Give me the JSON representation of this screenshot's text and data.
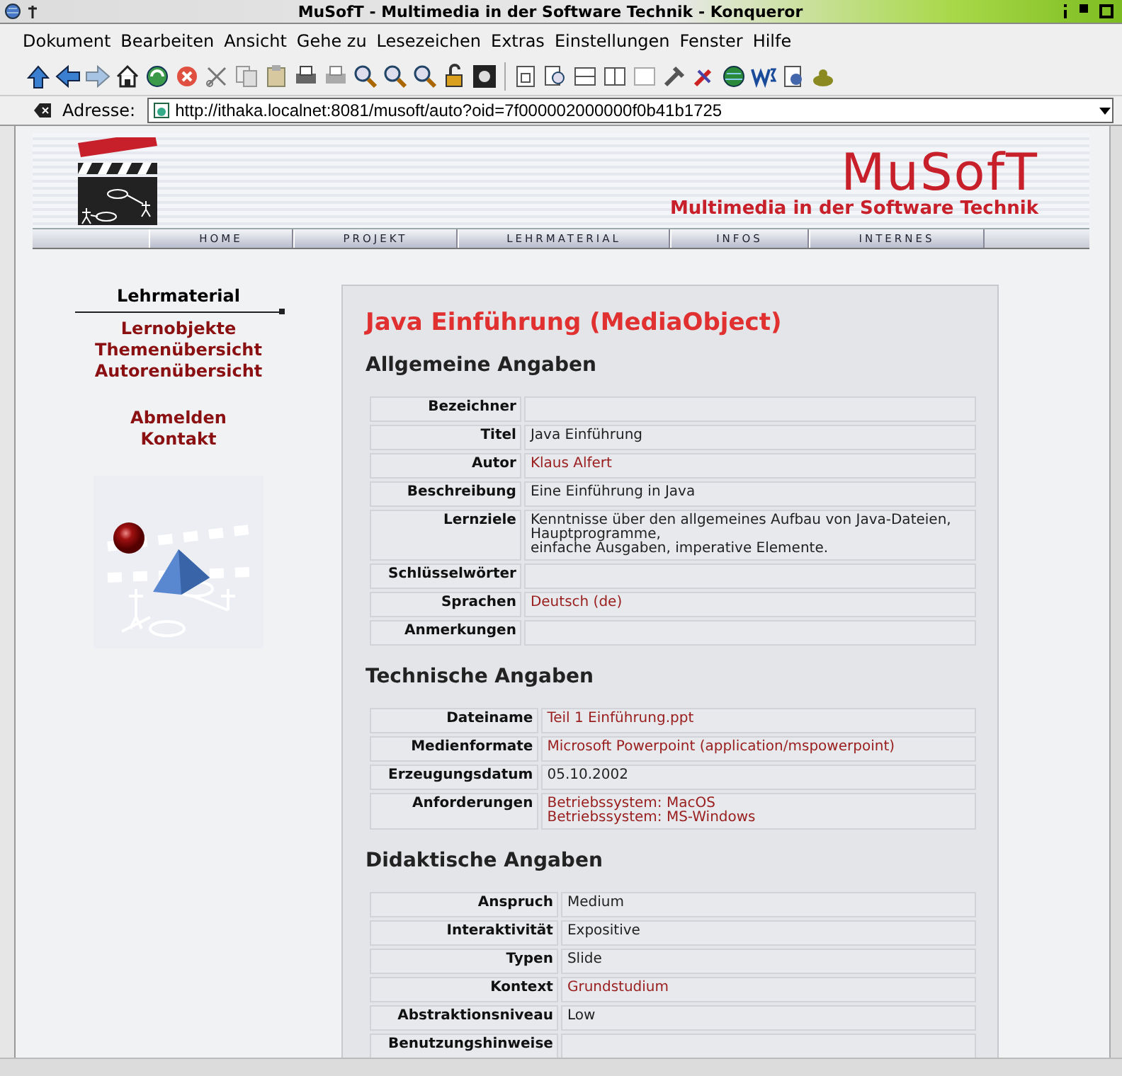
{
  "window": {
    "title": "MuSofT - Multimedia in der Software Technik - Konqueror"
  },
  "menu": [
    {
      "label": "Dokument"
    },
    {
      "label": "Bearbeiten"
    },
    {
      "label": "Ansicht"
    },
    {
      "label": "Gehe zu"
    },
    {
      "label": "Lesezeichen"
    },
    {
      "label": "Extras"
    },
    {
      "label": "Einstellungen"
    },
    {
      "label": "Fenster"
    },
    {
      "label": "Hilfe"
    }
  ],
  "address": {
    "label": "Adresse:",
    "url": "http://ithaka.localnet:8081/musoft/auto?oid=7f000002000000f0b41b1725"
  },
  "header": {
    "brand": "MuSofT",
    "subtitle": "Multimedia in der Software Technik"
  },
  "nav": [
    {
      "label": "HOME"
    },
    {
      "label": "PROJEKT"
    },
    {
      "label": "LEHRMATERIAL"
    },
    {
      "label": "INFOS"
    },
    {
      "label": "INTERNES"
    }
  ],
  "sidebar": {
    "heading": "Lehrmaterial",
    "links": [
      {
        "label": "Lernobjekte"
      },
      {
        "label": "Themenübersicht"
      },
      {
        "label": "Autorenübersicht"
      }
    ],
    "links2": [
      {
        "label": "Abmelden"
      },
      {
        "label": "Kontakt"
      }
    ]
  },
  "main": {
    "title": "Java Einführung (MediaObject)",
    "sections": [
      {
        "heading": "Allgemeine Angaben",
        "rows": [
          {
            "label": "Bezeichner",
            "kind": "text"
          },
          {
            "label": "Titel",
            "kind": "text",
            "lines": [
              "Java Einführung"
            ]
          },
          {
            "label": "Autor",
            "kind": "link",
            "lines": [
              "Klaus Alfert"
            ]
          },
          {
            "label": "Beschreibung",
            "kind": "text",
            "lines": [
              "Eine Einführung in Java"
            ]
          },
          {
            "label": "Lernziele",
            "kind": "text",
            "lines": [
              "Kenntnisse über den allgemeines Aufbau von Java-Dateien,",
              "Hauptprogramme,",
              "einfache Ausgaben, imperative Elemente."
            ]
          },
          {
            "label": "Schlüsselwörter",
            "kind": "text"
          },
          {
            "label": "Sprachen",
            "kind": "link",
            "lines": [
              "Deutsch (de)"
            ]
          },
          {
            "label": "Anmerkungen",
            "kind": "text"
          }
        ]
      },
      {
        "heading": "Technische Angaben",
        "rows": [
          {
            "label": "Dateiname",
            "kind": "link",
            "lines": [
              "Teil 1 Einführung.ppt"
            ]
          },
          {
            "label": "Medienformate",
            "kind": "link",
            "lines": [
              "Microsoft Powerpoint (application/mspowerpoint)"
            ]
          },
          {
            "label": "Erzeugungsdatum",
            "kind": "text",
            "lines": [
              "05.10.2002"
            ]
          },
          {
            "label": "Anforderungen",
            "kind": "link",
            "lines": [
              "Betriebssystem: MacOS",
              "Betriebssystem: MS-Windows"
            ]
          }
        ]
      },
      {
        "heading": "Didaktische Angaben",
        "rows": [
          {
            "label": "Anspruch",
            "kind": "text",
            "lines": [
              "Medium"
            ]
          },
          {
            "label": "Interaktivität",
            "kind": "text",
            "lines": [
              "Expositive"
            ]
          },
          {
            "label": "Typen",
            "kind": "text",
            "lines": [
              "Slide"
            ]
          },
          {
            "label": "Kontext",
            "kind": "link",
            "lines": [
              "Grundstudium"
            ]
          },
          {
            "label": "Abstraktionsniveau",
            "kind": "text",
            "lines": [
              "Low"
            ]
          },
          {
            "label": "Benutzungshinweise",
            "kind": "text"
          }
        ]
      }
    ]
  }
}
